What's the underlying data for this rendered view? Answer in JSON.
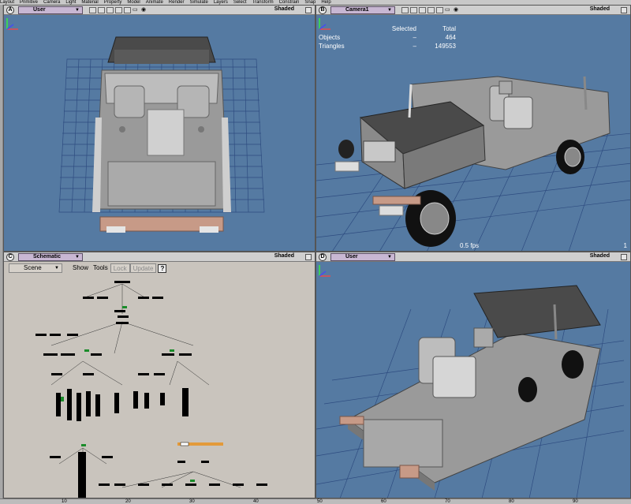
{
  "menu": [
    "Layout",
    "Primitive",
    "Camera",
    "Light",
    "Material",
    "Property",
    "Model",
    "Animate",
    "Render",
    "Simulate",
    "Layers",
    "Select",
    "Transform",
    "Constrain",
    "Snap",
    "Help"
  ],
  "viewports": {
    "a": {
      "letter": "A",
      "name": "User",
      "mode": "Shaded"
    },
    "b": {
      "letter": "B",
      "name": "Camera1",
      "mode": "Shaded",
      "stats": {
        "col_selected": "Selected",
        "col_total": "Total",
        "objects_label": "Objects",
        "objects_selected": "–",
        "objects_total": "464",
        "triangles_label": "Triangles",
        "triangles_selected": "–",
        "triangles_total": "149553"
      },
      "fps": "0.5 fps",
      "frame": "1"
    },
    "c": {
      "letter": "C",
      "name": "Schematic",
      "mode": "Shaded",
      "toolbar": {
        "scene": "Scene",
        "show": "Show",
        "tools": "Tools",
        "lock": "Lock",
        "update": "Update",
        "help": "?"
      }
    },
    "d": {
      "letter": "D",
      "name": "User",
      "mode": "Shaded"
    }
  },
  "timeline": {
    "ticks": [
      "10",
      "20",
      "30",
      "40",
      "50",
      "60",
      "70",
      "80",
      "90"
    ]
  },
  "colors": {
    "viewport_bg": "#557aa2",
    "grid": "#2e4c80",
    "schematic_bg": "#c9c4bd",
    "name_tab": "#c8b7d3"
  }
}
